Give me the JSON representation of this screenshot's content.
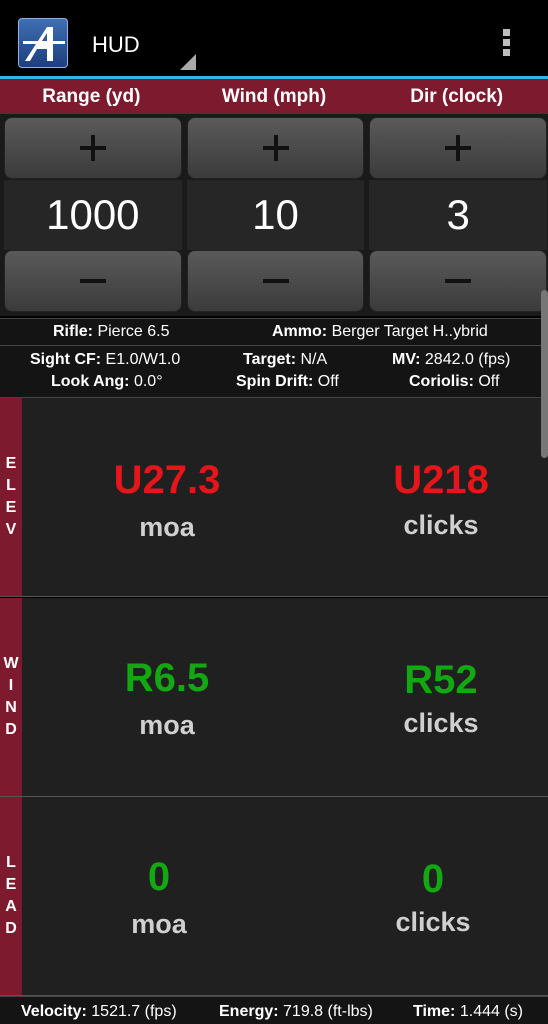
{
  "app": {
    "title": "HUD"
  },
  "header": {
    "range_label": "Range (yd)",
    "wind_label": "Wind (mph)",
    "dir_label": "Dir (clock)"
  },
  "inputs": {
    "range": "1000",
    "wind": "10",
    "dir": "3"
  },
  "info": {
    "rifle_label": "Rifle:",
    "rifle_value": "Pierce 6.5",
    "ammo_label": "Ammo:",
    "ammo_value": "Berger Target H..ybrid",
    "sight_label": "Sight CF:",
    "sight_value": "E1.0/W1.0",
    "target_label": "Target:",
    "target_value": "N/A",
    "mv_label": "MV:",
    "mv_value": "2842.0 (fps)",
    "look_label": "Look Ang:",
    "look_value": "0.0°",
    "spin_label": "Spin Drift:",
    "spin_value": "Off",
    "coriolis_label": "Coriolis:",
    "coriolis_value": "Off"
  },
  "sections": {
    "elev": {
      "side": [
        "E",
        "L",
        "E",
        "V"
      ],
      "moa_value": "U27.3",
      "moa_unit": "moa",
      "clicks_value": "U218",
      "clicks_unit": "clicks",
      "color": "#e5151a"
    },
    "wind": {
      "side": [
        "W",
        "I",
        "N",
        "D"
      ],
      "moa_value": "R6.5",
      "moa_unit": "moa",
      "clicks_value": "R52",
      "clicks_unit": "clicks",
      "color": "#12a812"
    },
    "lead": {
      "side": [
        "L",
        "E",
        "A",
        "D"
      ],
      "moa_value": "0",
      "moa_unit": "moa",
      "clicks_value": "0",
      "clicks_unit": "clicks",
      "color": "#12a812"
    }
  },
  "footer": {
    "velocity_label": "Velocity:",
    "velocity_value": "1521.7 (fps)",
    "energy_label": "Energy:",
    "energy_value": "719.8 (ft-lbs)",
    "time_label": "Time:",
    "time_value": "1.444 (s)"
  }
}
